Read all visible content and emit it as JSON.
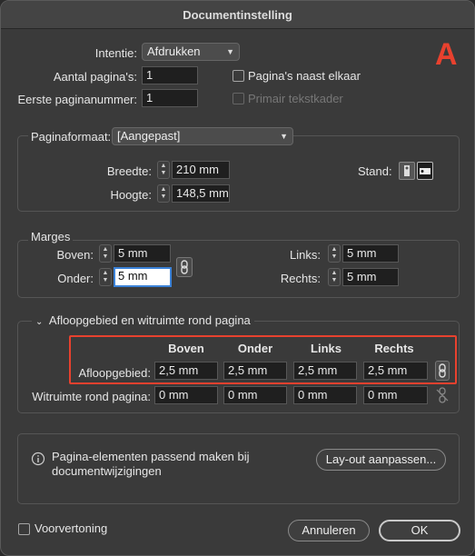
{
  "window": {
    "title": "Documentinstelling",
    "marker": "A"
  },
  "top": {
    "intent_label": "Intentie:",
    "intent_value": "Afdrukken",
    "pages_label": "Aantal pagina's:",
    "pages_value": "1",
    "first_page_label": "Eerste paginanummer:",
    "first_page_value": "1",
    "facing_pages_label": "Pagina's naast elkaar",
    "primary_frame_label": "Primair tekstkader"
  },
  "pagesize": {
    "format_label": "Paginaformaat:",
    "format_value": "[Aangepast]",
    "width_label": "Breedte:",
    "width_value": "210 mm",
    "height_label": "Hoogte:",
    "height_value": "148,5 mm",
    "orientation_label": "Stand:"
  },
  "margins": {
    "legend": "Marges",
    "top_label": "Boven:",
    "top_value": "5 mm",
    "bottom_label": "Onder:",
    "bottom_value": "5 mm",
    "left_label": "Links:",
    "left_value": "5 mm",
    "right_label": "Rechts:",
    "right_value": "5 mm"
  },
  "bleed": {
    "legend": "Afloopgebied en witruimte rond pagina",
    "col_top": "Boven",
    "col_bottom": "Onder",
    "col_left": "Links",
    "col_right": "Rechts",
    "bleed_label": "Afloopgebied:",
    "bleed_values": [
      "2,5 mm",
      "2,5 mm",
      "2,5 mm",
      "2,5 mm"
    ],
    "slug_label": "Witruimte rond pagina:",
    "slug_values": [
      "0 mm",
      "0 mm",
      "0 mm",
      "0 mm"
    ]
  },
  "info": {
    "text_line1": "Pagina-elementen passend maken bij",
    "text_line2": "documentwijzigingen",
    "adjust_button": "Lay-out aanpassen..."
  },
  "footer": {
    "preview_label": "Voorvertoning",
    "cancel_label": "Annuleren",
    "ok_label": "OK"
  },
  "colors": {
    "accent_red": "#e8412e",
    "focus_blue": "#3b82d8"
  }
}
